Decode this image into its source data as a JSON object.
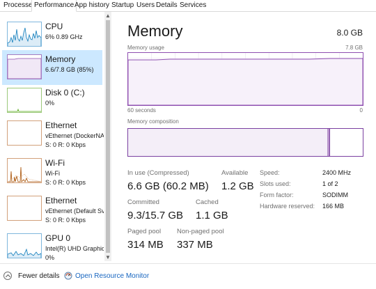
{
  "tabs": [
    "Processes",
    "Performance",
    "App history",
    "Startup",
    "Users",
    "Details",
    "Services"
  ],
  "active_tab": "Performance",
  "sidebar": {
    "items": [
      {
        "name": "CPU",
        "line1": "6%  0.89 GHz",
        "line2": ""
      },
      {
        "name": "Memory",
        "line1": "6.6/7.8 GB (85%)",
        "line2": ""
      },
      {
        "name": "Disk 0 (C:)",
        "line1": "0%",
        "line2": ""
      },
      {
        "name": "Ethernet",
        "line1": "vEthernet (DockerNA",
        "line2_s": "S: 0 R: 0 Kbps"
      },
      {
        "name": "Wi-Fi",
        "line1": "Wi-Fi",
        "line2_s": "S: 0 R: 0 Kbps"
      },
      {
        "name": "Ethernet",
        "line1": "vEthernet (Default Sv",
        "line2_s": "S: 0 R: 0 Kbps"
      },
      {
        "name": "GPU 0",
        "line1": "Intel(R) UHD Graphic",
        "line2": "0%"
      }
    ]
  },
  "main": {
    "title": "Memory",
    "total": "8.0 GB",
    "usage_label": "Memory usage",
    "usage_max": "7.8 GB",
    "time_left": "60 seconds",
    "time_right": "0",
    "composition_label": "Memory composition",
    "usage_fraction": 0.85,
    "stats": {
      "in_use_label": "In use (Compressed)",
      "in_use_value": "6.6 GB (60.2 MB)",
      "available_label": "Available",
      "available_value": "1.2 GB",
      "committed_label": "Committed",
      "committed_value": "9.3/15.7 GB",
      "cached_label": "Cached",
      "cached_value": "1.1 GB",
      "paged_label": "Paged pool",
      "paged_value": "314 MB",
      "nonpaged_label": "Non-paged pool",
      "nonpaged_value": "337 MB"
    },
    "specs": {
      "speed_label": "Speed:",
      "speed_value": "2400 MHz",
      "slots_label": "Slots used:",
      "slots_value": "1 of 2",
      "form_label": "Form factor:",
      "form_value": "SODIMM",
      "reserved_label": "Hardware reserved:",
      "reserved_value": "166 MB"
    }
  },
  "footer": {
    "fewer_details": "Fewer details",
    "resource_monitor": "Open Resource Monitor"
  },
  "colors": {
    "memory_accent": "#8e4eb0",
    "cpu_accent": "#117dbb",
    "disk_accent": "#4da60c",
    "net_accent": "#a74f01",
    "selected_bg": "#cce8ff",
    "link": "#1866c0"
  }
}
